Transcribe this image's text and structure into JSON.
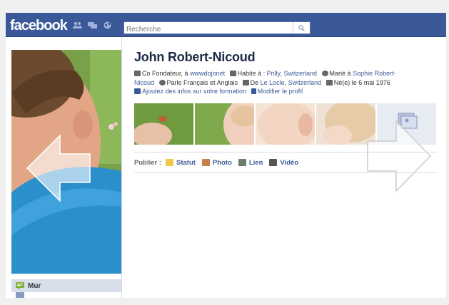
{
  "topbar": {
    "logo": "facebook",
    "search_placeholder": "Recherche"
  },
  "profile": {
    "name": "John Robert-Nicoud",
    "line1_job_prefix": "Co Fondateur, à",
    "line1_job_link": "wwwdojonet",
    "line1_lives_prefix": "Habite à :",
    "line1_lives_link": "Prilly, Switzerland",
    "line1_married_prefix": "Marié à",
    "line1_married_link": "Sophie Robert-",
    "line2_married_link_cont": "Nicoud",
    "line2_languages": "Parle Français et Anglais",
    "line2_from_prefix": "De",
    "line2_from_link": "Le Locle, Switzerland",
    "line2_born": "Né(e) le 6 mai 1976",
    "line3_add_education": "Ajoutez des infos sur votre formation",
    "line3_edit_profile": "Modifier le profil"
  },
  "publisher": {
    "label": "Publier :",
    "items": [
      "Statut",
      "Photo",
      "Lien",
      "Vidéo"
    ]
  },
  "leftnav": {
    "items": [
      "Mur"
    ]
  },
  "colors": {
    "brand": "#3b5998",
    "nav_active": "#d8dfea"
  }
}
